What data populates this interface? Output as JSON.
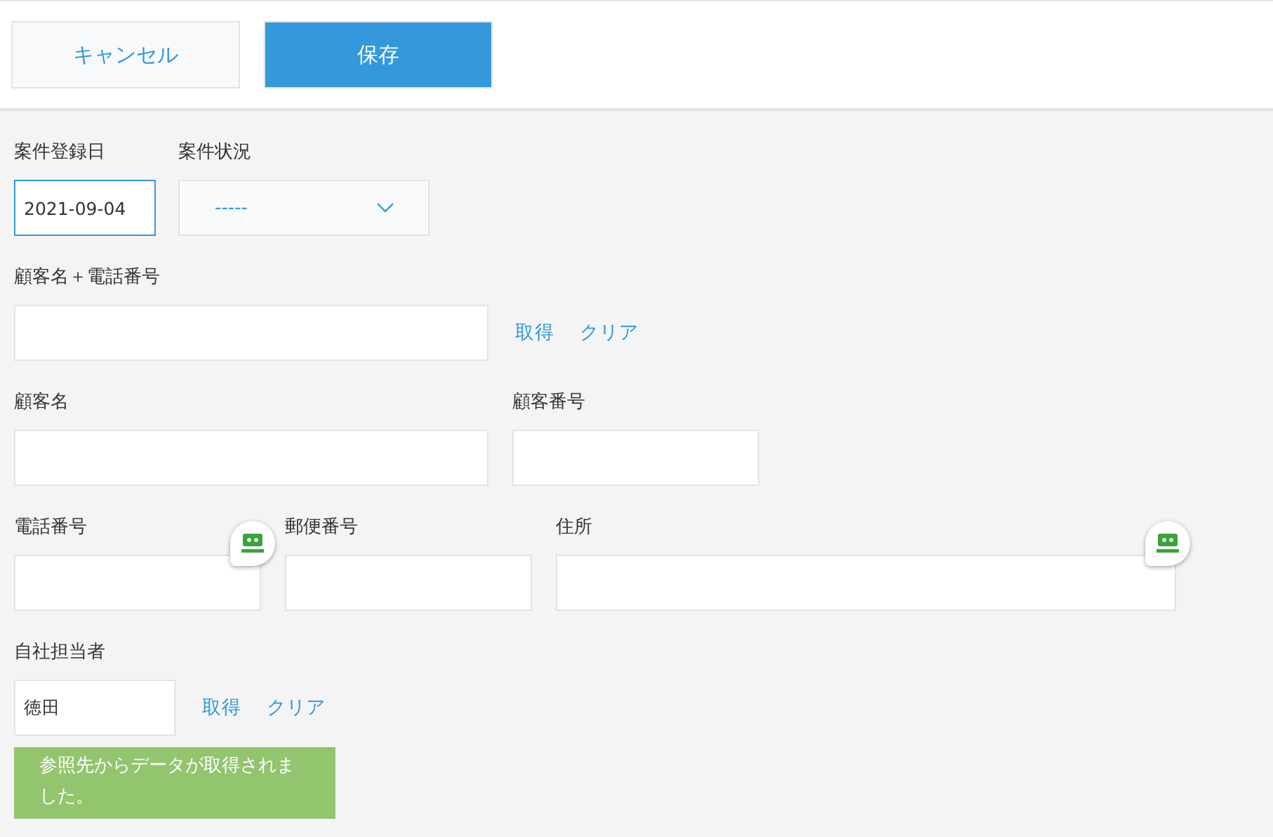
{
  "toolbar": {
    "buttons": [
      {
        "label": "キャンセル",
        "kind": "secondary"
      },
      {
        "label": "保存",
        "kind": "primary"
      }
    ]
  },
  "rows": [
    {
      "fields": [
        {
          "label": "案件登録日",
          "kind": "date",
          "value": "2021-09-04",
          "focused": true
        },
        {
          "label": "案件状況",
          "kind": "select",
          "value": "-----",
          "focused": false
        }
      ]
    },
    {
      "fields": [
        {
          "label": "顧客名＋電話番号",
          "kind": "text",
          "focused": false
        }
      ],
      "actions": [
        "取得",
        "クリア"
      ]
    },
    {
      "fields": [
        {
          "label": "顧客名",
          "kind": "text",
          "focused": false
        },
        {
          "label": "顧客番号",
          "kind": "text",
          "focused": false
        }
      ]
    },
    {
      "fields": [
        {
          "label": "電話番号",
          "kind": "text",
          "focused": false,
          "badge": true
        },
        {
          "label": "郵便番号",
          "kind": "text",
          "focused": false
        },
        {
          "label": "住所",
          "kind": "text",
          "focused": false,
          "badge": true
        }
      ]
    },
    {
      "fields": [
        {
          "label": "自社担当者",
          "kind": "text",
          "value": "徳田",
          "focused": false
        }
      ],
      "actions": [
        "取得",
        "クリア"
      ]
    }
  ],
  "notice": {
    "text": "参照先からデータが取得されました。"
  }
}
